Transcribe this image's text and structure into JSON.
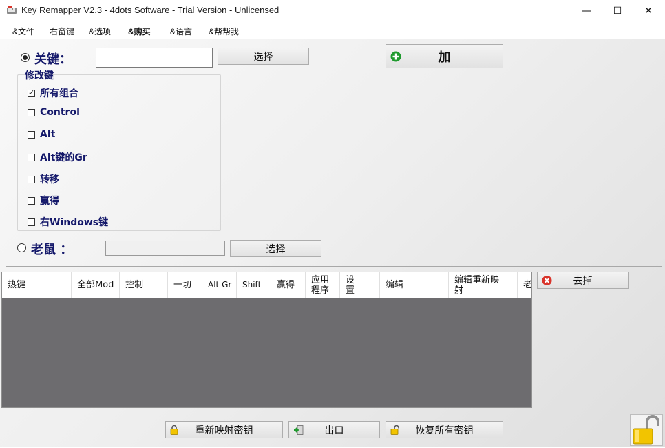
{
  "window": {
    "title": "Key Remapper V2.3 - 4dots Software - Trial Version - Unlicensed",
    "minimize_glyph": "—",
    "maximize_glyph": "☐",
    "close_glyph": "✕"
  },
  "menu": [
    "&文件",
    "右窗键",
    "&选项",
    "&购买",
    "&语言",
    "&帮帮我"
  ],
  "key_section": {
    "label": "关键：",
    "input_value": "",
    "select_label": "选择",
    "add_label": "加"
  },
  "modifiers": {
    "title": "修改键",
    "items": [
      {
        "label": "所有组合",
        "checked": true
      },
      {
        "label": "Control",
        "checked": false
      },
      {
        "label": "Alt",
        "checked": false
      },
      {
        "label": "Alt键的Gr",
        "checked": false
      },
      {
        "label": "转移",
        "checked": false
      },
      {
        "label": "赢得",
        "checked": false
      },
      {
        "label": "右Windows键",
        "checked": false
      }
    ]
  },
  "mouse_section": {
    "label": "老鼠 ：",
    "input_value": "",
    "select_label": "选择"
  },
  "grid": {
    "columns": [
      "热键",
      "全部Mod",
      "控制",
      "一切",
      "Alt Gr",
      "Shift",
      "赢得",
      "应用\n程序",
      "设\n置",
      "编辑",
      "编辑重新映\n射",
      "老"
    ]
  },
  "remove_label": "去掉",
  "bottom_buttons": {
    "remap": "重新映射密钥",
    "exit": "出口",
    "restore": "恢复所有密钥"
  },
  "colors": {
    "label_blue": "#14186a",
    "grid_background": "#6d6c6f",
    "add_icon_green": "#1f9a2e",
    "remove_icon_red": "#d9342b",
    "lock_yellow": "#f2c400"
  }
}
